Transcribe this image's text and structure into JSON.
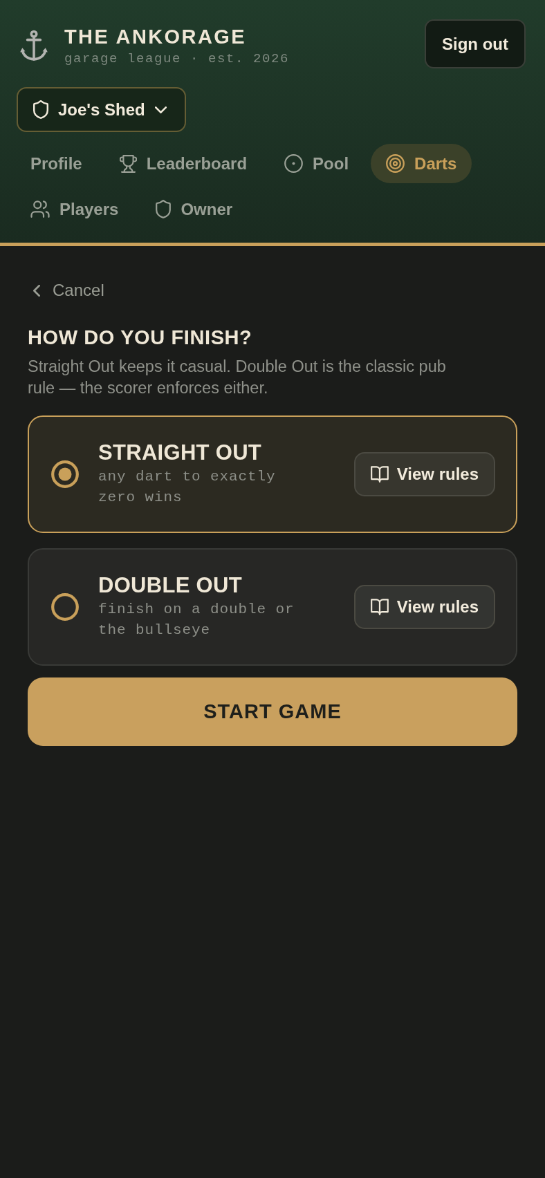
{
  "brand": {
    "title": "THE ANKORAGE",
    "subtitle": "garage league · est. 2026"
  },
  "sign_out": "Sign out",
  "venue_select": {
    "value": "Joe's Shed"
  },
  "nav": [
    {
      "label": "Profile",
      "selected": false
    },
    {
      "label": "Leaderboard",
      "selected": false
    },
    {
      "label": "Pool",
      "selected": false
    },
    {
      "label": "Darts",
      "selected": true
    },
    {
      "label": "Players",
      "selected": false
    },
    {
      "label": "Owner",
      "selected": false
    }
  ],
  "back_link": "Cancel",
  "heading": "HOW DO YOU FINISH?",
  "description": "Straight Out keeps it casual. Double Out is the classic pub rule — the scorer enforces either.",
  "options": [
    {
      "title": "STRAIGHT OUT",
      "description": "any dart to exactly zero wins",
      "button": "View rules",
      "selected": true
    },
    {
      "title": "DOUBLE OUT",
      "description": "finish on a double or the bullseye",
      "button": "View rules",
      "selected": false
    }
  ],
  "start_button": "START GAME"
}
